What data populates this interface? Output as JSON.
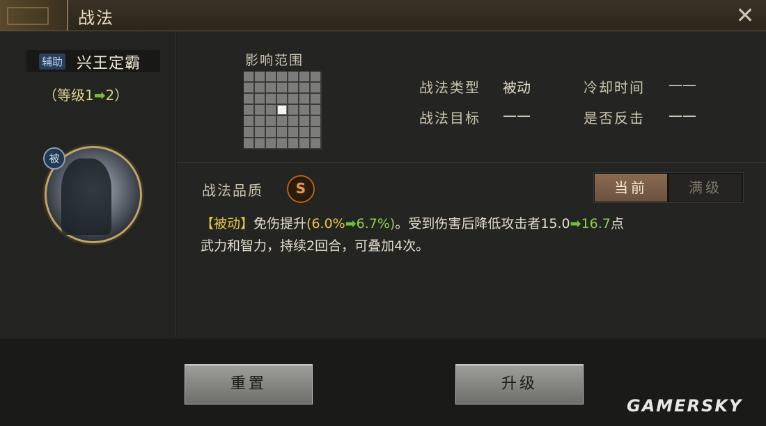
{
  "window": {
    "title": "战法",
    "close_symbol": "✕"
  },
  "general": {
    "role_badge": "辅助",
    "name": "兴王定霸",
    "level": {
      "open": "（等级1",
      "arrow": "➡",
      "close": "2）"
    },
    "portrait_tag": "被"
  },
  "range": {
    "label": "影响范围"
  },
  "info": {
    "type_label": "战法类型",
    "type_value": "被动",
    "cooldown_label": "冷却时间",
    "cooldown_value": "——",
    "target_label": "战法目标",
    "target_value": "——",
    "counter_label": "是否反击",
    "counter_value": "——"
  },
  "quality": {
    "label": "战法品质",
    "grade": "S"
  },
  "toggle": {
    "current": "当前",
    "max": "满级"
  },
  "description": {
    "tag": "【被动】",
    "p1": "免伤提升",
    "v1_open": "(6.0%",
    "arrow": "➡",
    "v1_new": "6.7%)",
    "p2": "。受到伤害后降低攻击者",
    "v2_old": "15.0",
    "v2_new": "16.7",
    "p3": "点",
    "line2": "武力和智力，持续2回合，可叠加4次。"
  },
  "buttons": {
    "reset": "重置",
    "upgrade": "升级"
  },
  "watermark": "GAMERSKY",
  "colors": {
    "accent_green": "#8fd24a",
    "highlight_yellow": "#e6c64a",
    "quality_orange": "#e89b48"
  }
}
